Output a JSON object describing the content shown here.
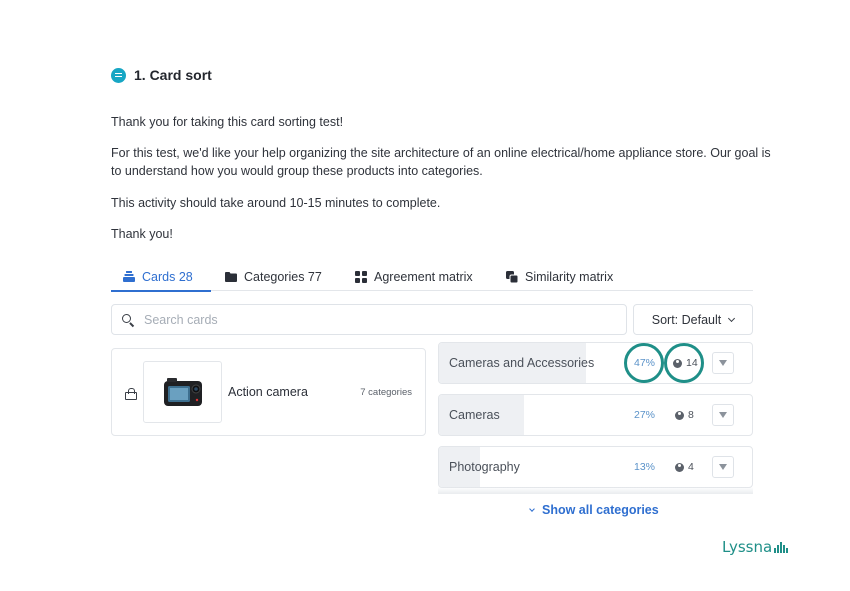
{
  "section": {
    "title": "1. Card sort"
  },
  "intro": {
    "p1": "Thank you for taking this card sorting test!",
    "p2": "For this test, we'd like your help organizing the site architecture of an online electrical/home appliance store. Our goal is to understand how you would group these products into categories.",
    "p3": "This activity should take around 10-15 minutes to complete.",
    "p4": "Thank you!"
  },
  "tabs": [
    {
      "label": "Cards 28",
      "icon": "cards-stack-icon",
      "active": true
    },
    {
      "label": "Categories 77",
      "icon": "folder-icon",
      "active": false
    },
    {
      "label": "Agreement matrix",
      "icon": "grid-icon",
      "active": false
    },
    {
      "label": "Similarity matrix",
      "icon": "overlap-squares-icon",
      "active": false
    }
  ],
  "search": {
    "placeholder": "Search cards"
  },
  "sort": {
    "label": "Sort: Default"
  },
  "card": {
    "name": "Action camera",
    "count": "7 categories",
    "image": "action-camera-thumbnail"
  },
  "categories": [
    {
      "name": "Cameras and Accessories",
      "percent": "47%",
      "users": "14",
      "fill": 0.47
    },
    {
      "name": "Cameras",
      "percent": "27%",
      "users": "8",
      "fill": 0.27
    },
    {
      "name": "Photography",
      "percent": "13%",
      "users": "4",
      "fill": 0.13
    }
  ],
  "show_all": {
    "label": "Show all categories"
  },
  "brand": {
    "name": "Lyssna"
  },
  "colors": {
    "accent": "#2f6fd0",
    "highlight": "#1f8f88",
    "percent": "#5b93c9",
    "section_icon": "#17a6c4"
  }
}
